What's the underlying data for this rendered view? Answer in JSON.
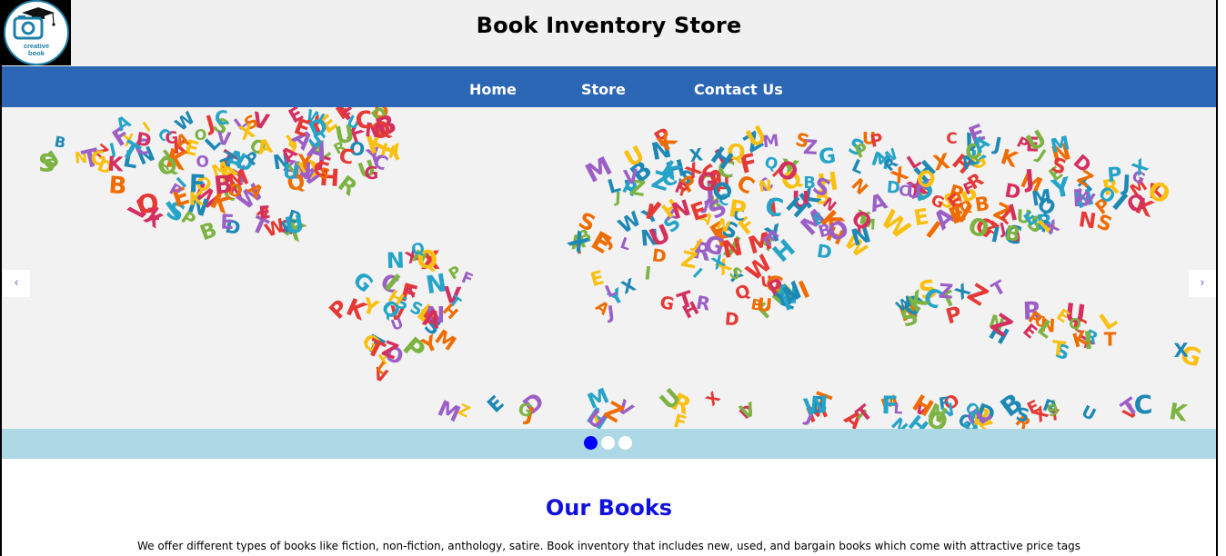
{
  "header": {
    "title": "Book Inventory Store",
    "logo": {
      "line1": "creative",
      "line2": "book",
      "icon": "camera-graduation-cap-logo"
    }
  },
  "nav": {
    "items": [
      {
        "label": "Home"
      },
      {
        "label": "Store"
      },
      {
        "label": "Contact Us"
      }
    ],
    "background": "#2c67b5"
  },
  "carousel": {
    "prev_label": "‹",
    "next_label": "›",
    "slide_count": 3,
    "active_slide": 1,
    "image": "alphabet-letters-world-map",
    "indicator_bar_color": "#add8e6",
    "active_dot_color": "#0000ff"
  },
  "section": {
    "title": "Our Books",
    "text": "We offer different types of books like fiction, non-fiction, anthology, satire. Book inventory that includes new, used, and bargain books which come with attractive price tags"
  }
}
